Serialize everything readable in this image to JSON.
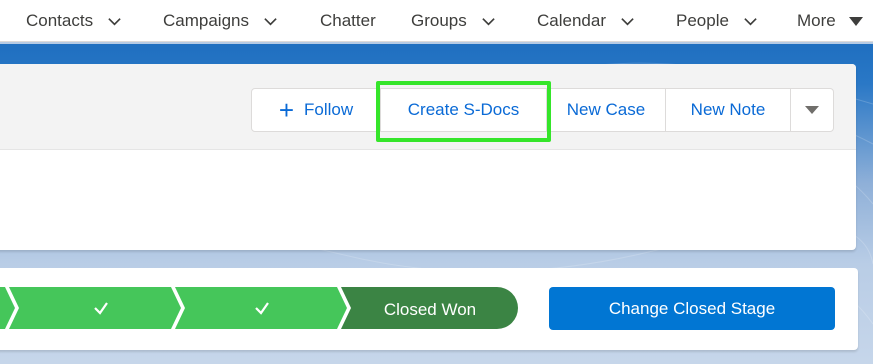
{
  "nav": {
    "items": [
      {
        "label": "Contacts"
      },
      {
        "label": "Campaigns"
      },
      {
        "label": "Chatter"
      },
      {
        "label": "Groups"
      },
      {
        "label": "Calendar"
      },
      {
        "label": "People"
      },
      {
        "label": "More"
      }
    ]
  },
  "actions": {
    "follow_label": "Follow",
    "create_sdocs_label": "Create S-Docs",
    "new_case_label": "New Case",
    "new_note_label": "New Note",
    "more_actions_icon": "caret-down-icon"
  },
  "path": {
    "completed_steps": 3,
    "current_step_label": "Closed Won",
    "change_stage_label": "Change Closed Stage"
  },
  "colors": {
    "brand_blue": "#0176d3",
    "path_complete": "#45c65a",
    "path_current": "#3b8444",
    "highlight": "#35e52a",
    "nav_text": "#3e3e3c"
  }
}
